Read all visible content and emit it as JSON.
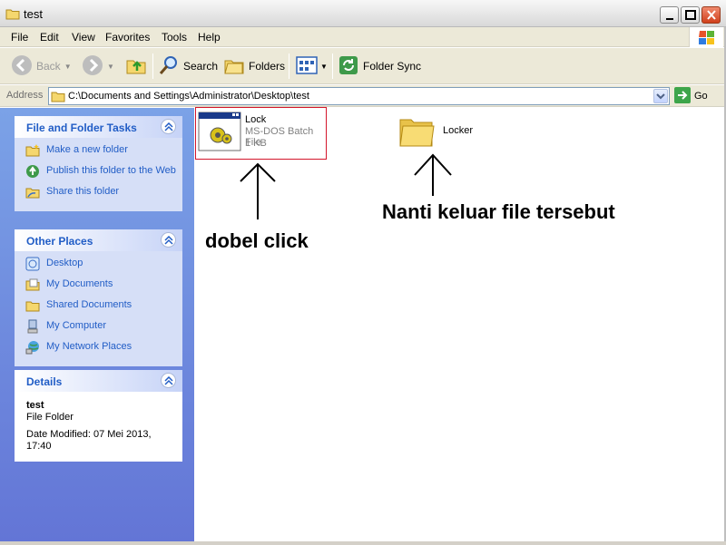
{
  "window": {
    "title": "test",
    "icon": "folder-icon"
  },
  "menu": [
    "File",
    "Edit",
    "View",
    "Favorites",
    "Tools",
    "Help"
  ],
  "toolbar": {
    "back_label": "Back",
    "search_label": "Search",
    "folders_label": "Folders",
    "folder_sync_label": "Folder Sync"
  },
  "address": {
    "label": "Address",
    "path": "C:\\Documents and Settings\\Administrator\\Desktop\\test",
    "go_label": "Go"
  },
  "sidebar": {
    "tasks": {
      "title": "File and Folder Tasks",
      "items": [
        {
          "label": "Make a new folder",
          "icon": "new-folder-icon"
        },
        {
          "label": "Publish this folder to the Web",
          "icon": "publish-web-icon"
        },
        {
          "label": "Share this folder",
          "icon": "share-folder-icon"
        }
      ]
    },
    "places": {
      "title": "Other Places",
      "items": [
        {
          "label": "Desktop",
          "icon": "desktop-icon"
        },
        {
          "label": "My Documents",
          "icon": "my-documents-icon"
        },
        {
          "label": "Shared Documents",
          "icon": "shared-documents-icon"
        },
        {
          "label": "My Computer",
          "icon": "my-computer-icon"
        },
        {
          "label": "My Network Places",
          "icon": "network-places-icon"
        }
      ]
    },
    "details": {
      "title": "Details",
      "name": "test",
      "type": "File Folder",
      "modified": "Date Modified: 07 Mei 2013, 17:40"
    }
  },
  "files": [
    {
      "name": "Lock",
      "type": "MS-DOS Batch File",
      "size": "1 KB",
      "icon": "batch-file-icon",
      "selected": true
    },
    {
      "name": "Locker",
      "icon": "folder-icon",
      "selected": false
    }
  ],
  "annotations": {
    "left": "dobel click",
    "right": "Nanti keluar file tersebut"
  },
  "colors": {
    "sidebar_gradient_top": "#7ba2e7",
    "sidebar_gradient_bottom": "#6375d6",
    "task_link": "#215dc6",
    "selection_outline": "#d3152b"
  }
}
